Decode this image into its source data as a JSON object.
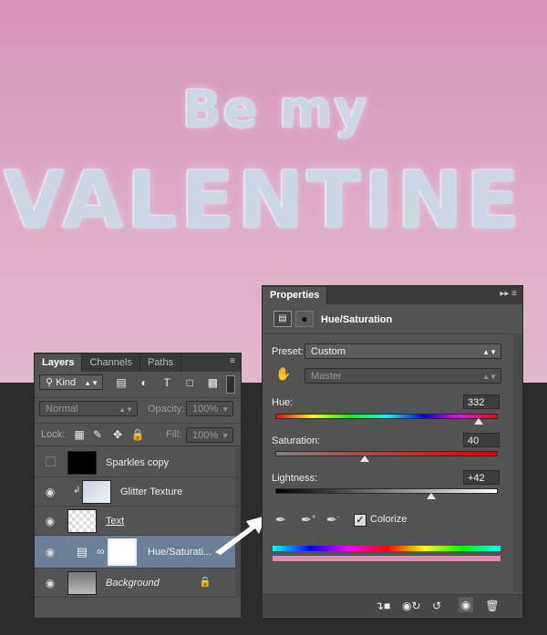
{
  "canvas": {
    "line1": "Be my",
    "line2": "VALENTINE"
  },
  "layers_panel": {
    "tabs": [
      {
        "label": "Layers",
        "active": true
      },
      {
        "label": "Channels",
        "active": false
      },
      {
        "label": "Paths",
        "active": false
      }
    ],
    "filter_label": "Kind",
    "blend_mode": "Normal",
    "opacity_label": "Opacity:",
    "opacity_value": "100%",
    "lock_label": "Lock:",
    "fill_label": "Fill:",
    "fill_value": "100%",
    "layers": [
      {
        "name": "Sparkles copy",
        "visible": false
      },
      {
        "name": "Glitter Texture",
        "visible": true
      },
      {
        "name": "Text",
        "visible": true
      },
      {
        "name": "Hue/Saturati...",
        "visible": true,
        "selected": true
      },
      {
        "name": "Background",
        "visible": true
      }
    ]
  },
  "properties_panel": {
    "tab": "Properties",
    "title": "Hue/Saturation",
    "preset_label": "Preset:",
    "preset_value": "Custom",
    "channel_value": "Master",
    "hue_label": "Hue:",
    "hue_value": "332",
    "saturation_label": "Saturation:",
    "saturation_value": "40",
    "lightness_label": "Lightness:",
    "lightness_value": "+42",
    "colorize_label": "Colorize",
    "colorize_checked": true,
    "slider_levels": {
      "hue": 0.92,
      "saturation": 0.4,
      "lightness": 0.71
    }
  }
}
